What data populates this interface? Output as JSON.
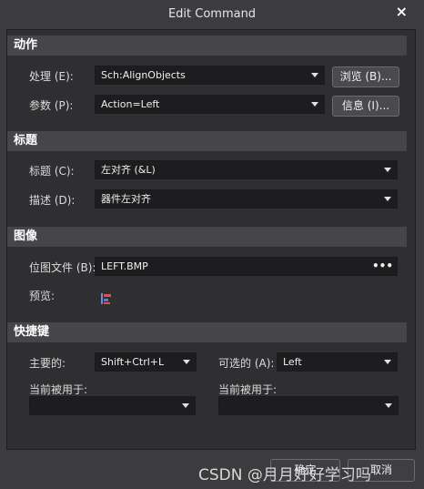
{
  "window": {
    "title": "Edit Command"
  },
  "sections": {
    "action": "动作",
    "caption": "标题",
    "image": "图像",
    "shortcut": "快捷键"
  },
  "action": {
    "process_label": "处理 (E):",
    "process_value": "Sch:AlignObjects",
    "browse_button": "浏览 (B)...",
    "params_label": "参数 (P):",
    "params_value": "Action=Left",
    "info_button": "信息 (I)..."
  },
  "caption": {
    "title_label": "标题 (C):",
    "title_value": "左对齐 (&L)",
    "desc_label": "描述 (D):",
    "desc_value": "器件左对齐"
  },
  "image": {
    "bitmap_label": "位图文件 (B):",
    "bitmap_value": "LEFT.BMP",
    "bitmap_button": "•••",
    "preview_label": "预览:"
  },
  "shortcut": {
    "primary_label": "主要的:",
    "primary_value": "Shift+Ctrl+L",
    "alternate_label": "可选的 (A):",
    "alternate_value": "Left",
    "primary_used_label": "当前被用于:",
    "primary_used_value": "",
    "alternate_used_label": "当前被用于:",
    "alternate_used_value": ""
  },
  "footer": {
    "ok_button": "确定",
    "cancel_button": "取消"
  },
  "watermark": "CSDN @月月好好学习吗",
  "icons": [
    "close-icon",
    "chevron-down-icon",
    "align-left-icon",
    "ellipsis-icon"
  ]
}
